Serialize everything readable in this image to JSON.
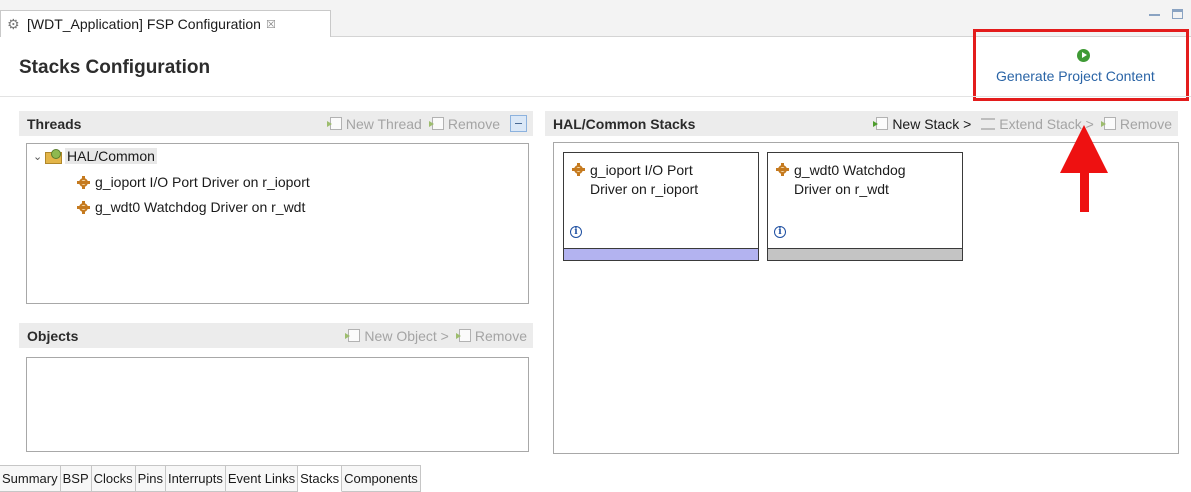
{
  "editor_tab": {
    "title": "[WDT_Application] FSP Configuration",
    "close_glyph": "☒"
  },
  "page_title": "Stacks Configuration",
  "generate": {
    "label": "Generate Project Content",
    "icon": "play-green-icon",
    "accent": "#e31c1c"
  },
  "threads_panel": {
    "title": "Threads",
    "actions": {
      "new_thread": "New Thread",
      "remove": "Remove"
    },
    "tree": {
      "root": "HAL/Common",
      "items": [
        "g_ioport I/O Port Driver on r_ioport",
        "g_wdt0 Watchdog Driver on r_wdt"
      ]
    }
  },
  "objects_panel": {
    "title": "Objects",
    "actions": {
      "new_object": "New Object >",
      "remove": "Remove"
    }
  },
  "stacks_panel": {
    "title": "HAL/Common Stacks",
    "actions": {
      "new_stack": "New Stack >",
      "extend_stack": "Extend Stack >",
      "remove": "Remove"
    },
    "cards": [
      {
        "line1": "g_ioport I/O Port",
        "line2": "Driver on r_ioport",
        "bar_color": "#b3b3f0"
      },
      {
        "line1": "g_wdt0 Watchdog",
        "line2": "Driver on r_wdt",
        "bar_color": "#c4c4c4"
      }
    ]
  },
  "bottom_tabs": [
    "Summary",
    "BSP",
    "Clocks",
    "Pins",
    "Interrupts",
    "Event Links",
    "Stacks",
    "Components"
  ],
  "active_bottom_tab": "Stacks"
}
